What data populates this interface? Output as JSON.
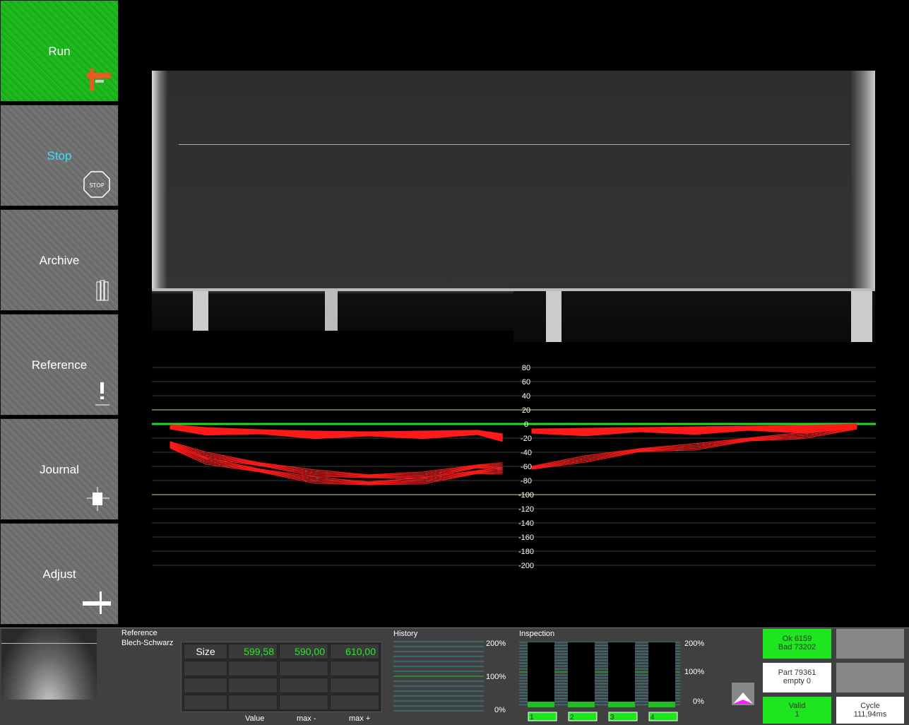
{
  "sidebar": {
    "items": [
      {
        "label": "Run",
        "icon": "caliper-icon"
      },
      {
        "label": "Stop",
        "icon": "stop-sign-icon"
      },
      {
        "label": "Archive",
        "icon": "archive-icon"
      },
      {
        "label": "Reference",
        "icon": "exclamation-icon"
      },
      {
        "label": "Journal",
        "icon": "journal-icon"
      },
      {
        "label": "Adjust",
        "icon": "ruler-icon"
      }
    ],
    "active_color": "#1eb81e",
    "stop_label_color": "#38e0ff"
  },
  "chart_data": {
    "type": "line",
    "y_ticks": [
      "80",
      "60",
      "40",
      "20",
      "0",
      "-20",
      "-40",
      "-60",
      "-80",
      "-100",
      "-120",
      "-140",
      "-160",
      "-180",
      "-200"
    ],
    "ylim": [
      -200,
      80
    ],
    "limit_lines": [
      20,
      -100
    ],
    "zero_line": 0,
    "grid": true,
    "series_left": [
      {
        "x": [
          0.05,
          0.15,
          0.3,
          0.45,
          0.6,
          0.75,
          0.9,
          0.97
        ],
        "values": [
          -2,
          -6,
          -9,
          -11,
          -12,
          -11,
          -10,
          -15
        ]
      },
      {
        "x": [
          0.05,
          0.15,
          0.3,
          0.45,
          0.6,
          0.75,
          0.9,
          0.97
        ],
        "values": [
          -25,
          -40,
          -55,
          -65,
          -72,
          -68,
          -58,
          -55
        ]
      },
      {
        "x": [
          0.05,
          0.15,
          0.3,
          0.45,
          0.6,
          0.75,
          0.9,
          0.97
        ],
        "values": [
          -30,
          -48,
          -64,
          -75,
          -82,
          -76,
          -66,
          -62
        ]
      }
    ],
    "series_right": [
      {
        "x": [
          0.05,
          0.2,
          0.35,
          0.5,
          0.65,
          0.8,
          0.95
        ],
        "values": [
          -8,
          -7,
          -6,
          -5,
          -4,
          -3,
          -1
        ]
      },
      {
        "x": [
          0.05,
          0.2,
          0.35,
          0.5,
          0.65,
          0.8,
          0.95
        ],
        "values": [
          -60,
          -45,
          -35,
          -28,
          -20,
          -12,
          -3
        ]
      }
    ],
    "colors": {
      "data": "#ff1a1a",
      "zero": "#22dd22",
      "limit": "#d8d870",
      "grid": "#3a3a3a"
    }
  },
  "reference": {
    "title": "Reference",
    "name": "Blech-Schwarz",
    "row_label": "Size",
    "value": "599,58",
    "max_minus": "590,00",
    "max_plus": "610,00",
    "col_value": "Value",
    "col_max_minus": "max -",
    "col_max_plus": "max +"
  },
  "history": {
    "title": "History",
    "tick_200": "200%",
    "tick_100": "100%",
    "tick_0": "0%"
  },
  "inspection": {
    "title": "Inspection",
    "tick_200": "200%",
    "tick_100": "100%",
    "tick_0": "0%",
    "bars": [
      "1",
      "2",
      "3",
      "4"
    ]
  },
  "status": {
    "ok": "Ok 6159",
    "bad": "Bad 73202",
    "part": "Part 79361",
    "empty": "empty 0",
    "valid": "Valid",
    "valid_count": "1",
    "cycle": "Cycle",
    "cycle_value": "111,94ms",
    "green": "#1ee61e"
  }
}
